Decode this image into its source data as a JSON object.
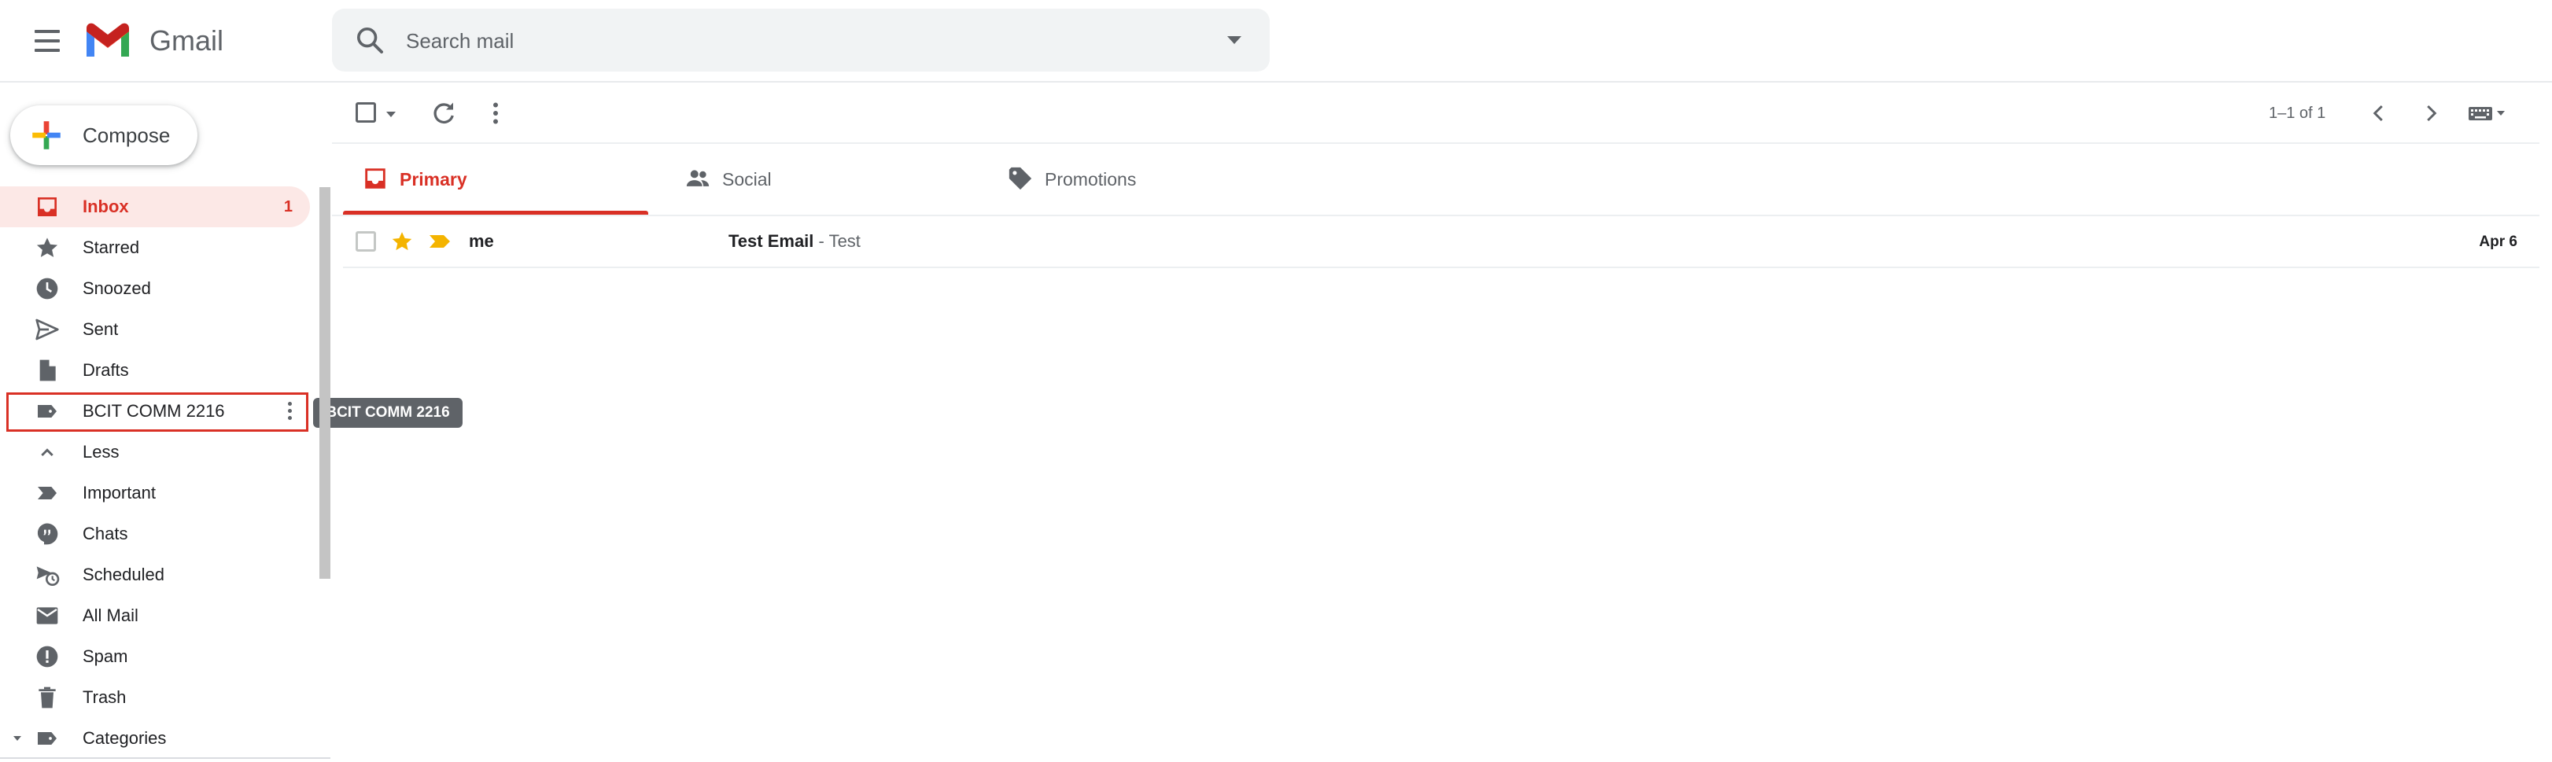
{
  "app": {
    "name": "Gmail"
  },
  "colors": {
    "accent": "#d93025",
    "star": "#f4b400",
    "important": "#f4b400",
    "icon": "#5f6368"
  },
  "search": {
    "placeholder": "Search mail",
    "value": ""
  },
  "compose": {
    "label": "Compose"
  },
  "sidebar": {
    "items": [
      {
        "label": "Inbox",
        "count": "1",
        "icon": "inbox-icon",
        "active": true
      },
      {
        "label": "Starred",
        "icon": "star-icon"
      },
      {
        "label": "Snoozed",
        "icon": "clock-icon"
      },
      {
        "label": "Sent",
        "icon": "send-icon"
      },
      {
        "label": "Drafts",
        "icon": "draft-icon"
      },
      {
        "label": "BCIT COMM 2216",
        "icon": "label-icon",
        "focused": true
      },
      {
        "label": "Less",
        "icon": "chevron-up-icon"
      },
      {
        "label": "Important",
        "icon": "important-icon"
      },
      {
        "label": "Chats",
        "icon": "chat-icon"
      },
      {
        "label": "Scheduled",
        "icon": "scheduled-icon"
      },
      {
        "label": "All Mail",
        "icon": "mail-icon"
      },
      {
        "label": "Spam",
        "icon": "spam-icon"
      },
      {
        "label": "Trash",
        "icon": "trash-icon"
      },
      {
        "label": "Categories",
        "icon": "label-icon"
      }
    ],
    "tooltip": "BCIT COMM 2216"
  },
  "toolbar": {
    "pagination": "1–1 of 1"
  },
  "tabs": [
    {
      "label": "Primary",
      "icon": "inbox-icon",
      "active": true
    },
    {
      "label": "Social",
      "icon": "people-icon"
    },
    {
      "label": "Promotions",
      "icon": "tag-icon"
    }
  ],
  "emails": [
    {
      "sender": "me",
      "subject": "Test Email",
      "snippet": " - Test",
      "date": "Apr 6",
      "starred": true,
      "important": true
    }
  ]
}
